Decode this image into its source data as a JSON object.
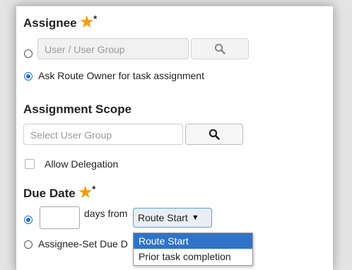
{
  "assignee": {
    "heading": "Assignee",
    "required_star": "★",
    "required_mark": "*",
    "user_field_placeholder": "User / User Group",
    "search_icon": "search-icon",
    "option_ask_route_owner": "Ask Route Owner for task assignment"
  },
  "assignment_scope": {
    "heading": "Assignment Scope",
    "user_group_placeholder": "Select User Group",
    "search_icon": "search-icon"
  },
  "allow_delegation": {
    "label": "Allow Delegation",
    "checked": false
  },
  "due_date": {
    "heading": "Due Date",
    "required_star": "★",
    "required_mark": "*",
    "days_value": "",
    "days_from_label": "days from",
    "selected_option": "Route Start",
    "caret": "▼",
    "option_assignee_set": "Assignee-Set Due D",
    "dropdown_options": [
      "Route Start",
      "Prior task completion"
    ]
  },
  "colors": {
    "accent": "#2f73c8",
    "required": "#f39c12",
    "radio_checked": "#1e6fd9"
  }
}
